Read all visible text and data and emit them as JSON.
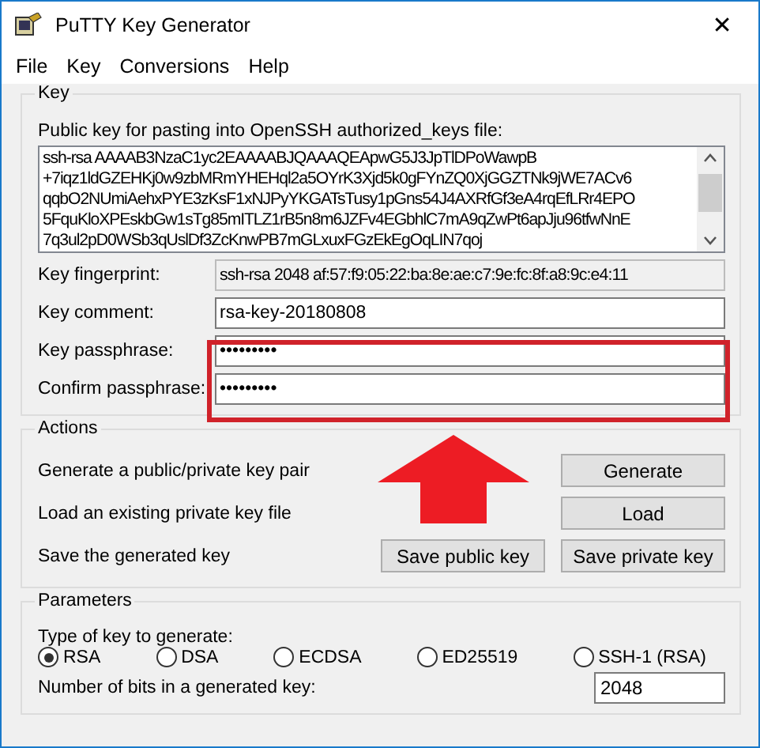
{
  "window": {
    "title": "PuTTY Key Generator",
    "close": "✕"
  },
  "menu": [
    "File",
    "Key",
    "Conversions",
    "Help"
  ],
  "key": {
    "title": "Key",
    "public_key_label": "Public key for pasting into OpenSSH authorized_keys file:",
    "public_key_lines": [
      "ssh-rsa AAAAB3NzaC1yc2EAAAABJQAAAQEApwG5J3JpTlDPoWawpB",
      "+7iqz1ldGZEHKj0w9zbMRmYHEHql2a5OYrK3Xjd5k0gFYnZQ0XjGGZTNk9jWE7ACv6",
      "qqbO2NUmiAehxPYE3zKsF1xNJPyYKGATsTusy1pGns54J4AXRfGf3eA4rqEfLRr4EPO",
      "5FquKloXPEskbGw1sTg85mITLZ1rB5n8m6JZFv4EGbhlC7mA9qZwPt6apJju96tfwNnE",
      "7q3ul2pD0WSb3qUslDf3ZcKnwPB7mGLxuxFGzEkEgOqLIN7qoj"
    ],
    "fields": [
      {
        "label": "Key fingerprint:",
        "value": "ssh-rsa 2048 af:57:f9:05:22:ba:8e:ae:c7:9e:fc:8f:a8:9c:e4:11",
        "disabled": true
      },
      {
        "label": "Key comment:",
        "value": "rsa-key-20180808",
        "disabled": false
      },
      {
        "label": "Key passphrase:",
        "value": "•••••••••",
        "disabled": false
      },
      {
        "label": "Confirm passphrase:",
        "value": "•••••••••",
        "disabled": false
      }
    ]
  },
  "actions": {
    "title": "Actions",
    "rows": [
      {
        "label": "Generate a public/private key pair",
        "buttons": [
          "Generate"
        ]
      },
      {
        "label": "Load an existing private key file",
        "buttons": [
          "Load"
        ]
      },
      {
        "label": "Save the generated key",
        "buttons": [
          "Save public key",
          "Save private key"
        ]
      }
    ]
  },
  "parameters": {
    "title": "Parameters",
    "type_label": "Type of key to generate:",
    "types": [
      {
        "label": "RSA",
        "selected": true
      },
      {
        "label": "DSA",
        "selected": false
      },
      {
        "label": "ECDSA",
        "selected": false
      },
      {
        "label": "ED25519",
        "selected": false
      },
      {
        "label": "SSH-1 (RSA)",
        "selected": false
      }
    ],
    "bits_label": "Number of bits in a generated key:",
    "bits": "2048"
  }
}
